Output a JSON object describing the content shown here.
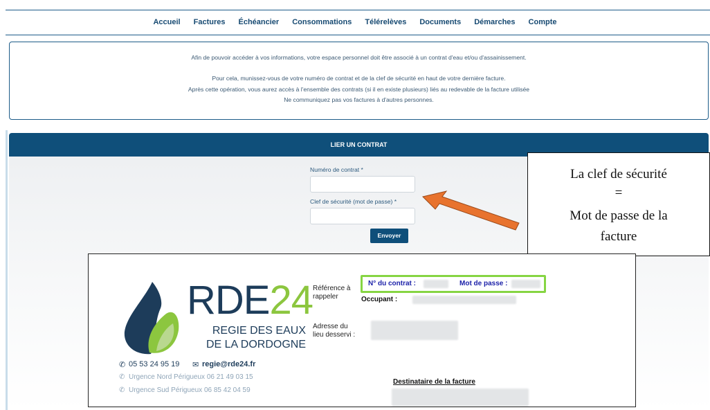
{
  "nav": {
    "items": [
      "Accueil",
      "Factures",
      "Échéancier",
      "Consommations",
      "Télérelèves",
      "Documents",
      "Démarches",
      "Compte"
    ]
  },
  "info": {
    "line1": "Afin de pouvoir accéder à vos informations, votre espace personnel doit être associé à un contrat d'eau et/ou d'assainissement.",
    "line2": "Pour cela, munissez-vous de votre numéro de contrat et de la clef de sécurité en haut de votre dernière facture.",
    "line3": "Après cette opération, vous aurez accès à l'ensemble des contrats (si il en existe plusieurs) liés au redevable de la facture utilisée",
    "line4": "Ne communiquez pas vos factures à d'autres personnes."
  },
  "form": {
    "title": "LIER UN CONTRAT",
    "contract_label": "Numéro de contrat *",
    "contract_value": "",
    "key_label": "Clef de sécurité (mot de passe) *",
    "key_value": "",
    "submit_label": "Envoyer"
  },
  "callout": {
    "line1": "La clef de sécurité",
    "line2": "=",
    "line3": "Mot de passe de la",
    "line4": "facture"
  },
  "invoice": {
    "logo_main": "RDE",
    "logo_number": "24",
    "logo_sub1": "REGIE DES EAUX",
    "logo_sub2": "DE LA DORDOGNE",
    "phone": "05 53 24 95 19",
    "email": "regie@rde24.fr",
    "urgence_nord": "Urgence Nord Périgueux 06 21 49 03 15",
    "urgence_sud": "Urgence Sud Périgueux 06 85 42 04 59",
    "ref_label_1": "Référence à",
    "ref_label_2": "rappeler",
    "contract_ref": "N° du contrat :",
    "password_ref": "Mot de passe :",
    "occupant": "Occupant :",
    "address_label_1": "Adresse du",
    "address_label_2": "lieu desservi :",
    "recipient": "Destinataire de la facture"
  },
  "colors": {
    "brand_blue": "#0f4f7a",
    "arrow_orange": "#e8732e",
    "highlight_green": "#86d543",
    "link_blue": "#1a1fa8"
  }
}
